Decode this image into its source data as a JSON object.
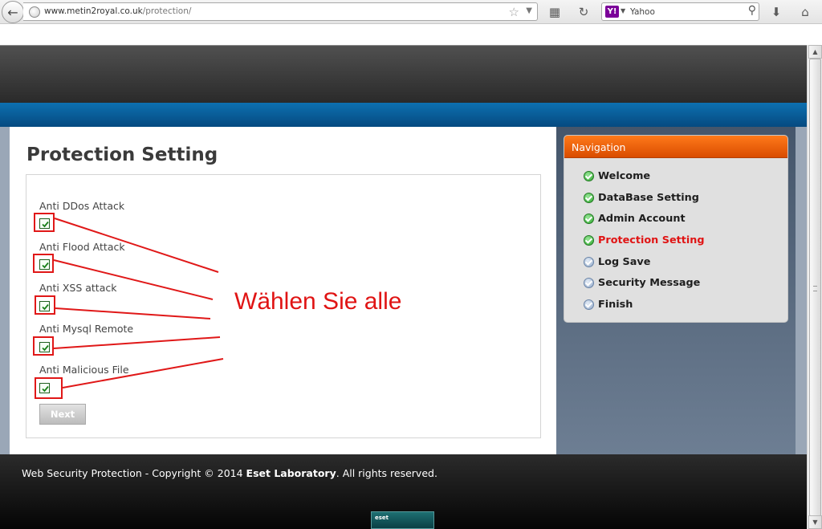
{
  "browser": {
    "url_domain": "www.metin2royal.co.uk",
    "url_path": "/protection/",
    "search_engine": "Yahoo",
    "search_icon_letter": "Y!",
    "icons": [
      "back-arrow-icon",
      "globe-icon",
      "bookmark-star-icon",
      "dropdown-arrow-icon",
      "addon-icon",
      "reload-icon",
      "yahoo-icon",
      "magnifier-icon",
      "download-arrow-icon",
      "home-icon"
    ]
  },
  "page": {
    "title": "Protection Setting",
    "options": [
      {
        "label": "Anti DDos Attack",
        "checked": true
      },
      {
        "label": "Anti Flood Attack",
        "checked": true
      },
      {
        "label": "Anti XSS attack",
        "checked": true
      },
      {
        "label": "Anti Mysql Remote",
        "checked": true
      },
      {
        "label": "Anti Malicious File",
        "checked": true
      }
    ],
    "next_label": "Next",
    "annotation": "Wählen Sie alle",
    "annotation_color": "#e01414"
  },
  "nav": {
    "header": "Navigation",
    "header_color": "#ef6a10",
    "items": [
      {
        "label": "Welcome",
        "status": "done"
      },
      {
        "label": "DataBase Setting",
        "status": "done"
      },
      {
        "label": "Admin Account",
        "status": "done"
      },
      {
        "label": "Protection Setting",
        "status": "current"
      },
      {
        "label": "Log Save",
        "status": "todo"
      },
      {
        "label": "Security Message",
        "status": "todo"
      },
      {
        "label": "Finish",
        "status": "todo"
      }
    ]
  },
  "footer": {
    "prefix": "Web Security Protection - Copyright © 2014 ",
    "company": "Eset Laboratory",
    "suffix": ". All rights reserved.",
    "logo_text": "eset"
  }
}
